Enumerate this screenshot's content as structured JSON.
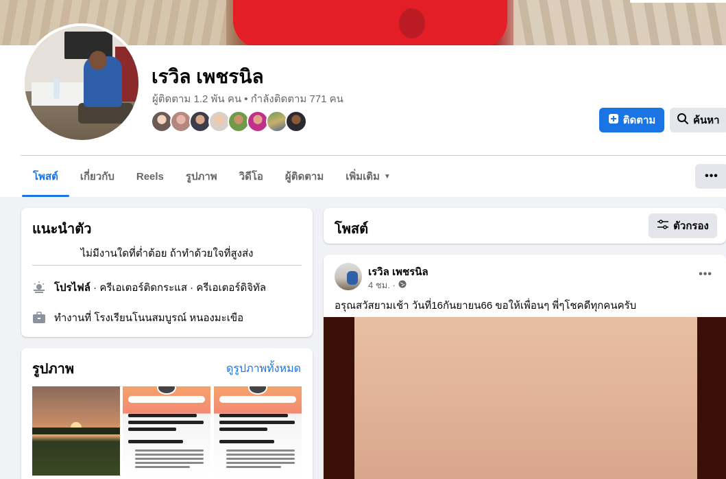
{
  "profile": {
    "name": "เรวิล เพชรนิล",
    "follow_stats": "ผู้ติดตาม 1.2 พัน คน • กำลังติดตาม 771 คน",
    "follow_button": "ติดตาม",
    "search_button": "ค้นหา"
  },
  "tabs": [
    {
      "label": "โพสต์"
    },
    {
      "label": "เกี่ยวกับ"
    },
    {
      "label": "Reels"
    },
    {
      "label": "รูปภาพ"
    },
    {
      "label": "วิดีโอ"
    },
    {
      "label": "ผู้ติดตาม"
    },
    {
      "label": "เพิ่มเติม"
    }
  ],
  "intro": {
    "title": "แนะนำตัว",
    "bio": "ไม่มีงานใดที่ต่ำต้อย ถ้าทำด้วยใจที่สูงส่ง",
    "profile_label": "โปรไฟล์",
    "profile_detail": " · ครีเอเตอร์ติดกระแส · ครีเอเตอร์ดิจิทัล",
    "work": "ทำงานที่ โรงเรียนโนนสมบูรณ์ หนองมะเขือ"
  },
  "photos": {
    "title": "รูปภาพ",
    "see_all": "ดูรูปภาพทั้งหมด"
  },
  "posts": {
    "title": "โพสต์",
    "filter_button": "ตัวกรอง"
  },
  "post": {
    "author": "เรวิล เพชรนิล",
    "time": "4 ชม. ·",
    "text": "อรุณสวัสยามเช้า วันที่16กันยายน66  ขอให้เพื่อนๆ พี่ๆโชคดีทุกคนครับ"
  },
  "colors": {
    "accent": "#1b74e4",
    "background": "#f0f2f5"
  }
}
